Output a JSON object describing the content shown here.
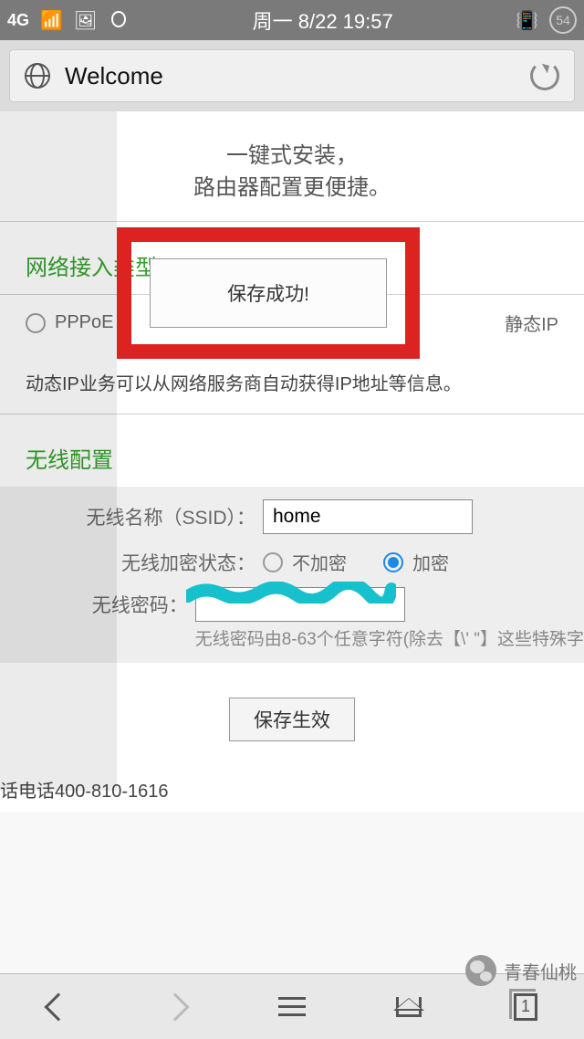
{
  "status": {
    "network": "4G",
    "date_time": "周一 8/22 19:57",
    "battery": "54"
  },
  "urlbar": {
    "title": "Welcome"
  },
  "page": {
    "header_line1": "一键式安装，",
    "header_line2": "路由器配置更便捷。",
    "network_type_title": "网络接入类型",
    "conn_options": {
      "pppoe": "PPPoE",
      "static": "静态IP"
    },
    "dialog": "保存成功!",
    "desc": "动态IP业务可以从网络服务商自动获得IP地址等信息。",
    "wifi_title": "无线配置",
    "ssid_label": "无线名称（SSID）：",
    "ssid_value": "home",
    "encrypt_label": "无线加密状态：",
    "encrypt_off": "不加密",
    "encrypt_on": "加密",
    "pwd_label": "无线密码：",
    "pwd_hint": "无线密码由8-63个任意字符(除去【\\' \"】这些特殊字",
    "save_btn": "保存生效",
    "phone": "话电话400-810-1616"
  },
  "nav": {
    "tab_count": "1"
  },
  "watermark": {
    "text": "青春仙桃"
  }
}
